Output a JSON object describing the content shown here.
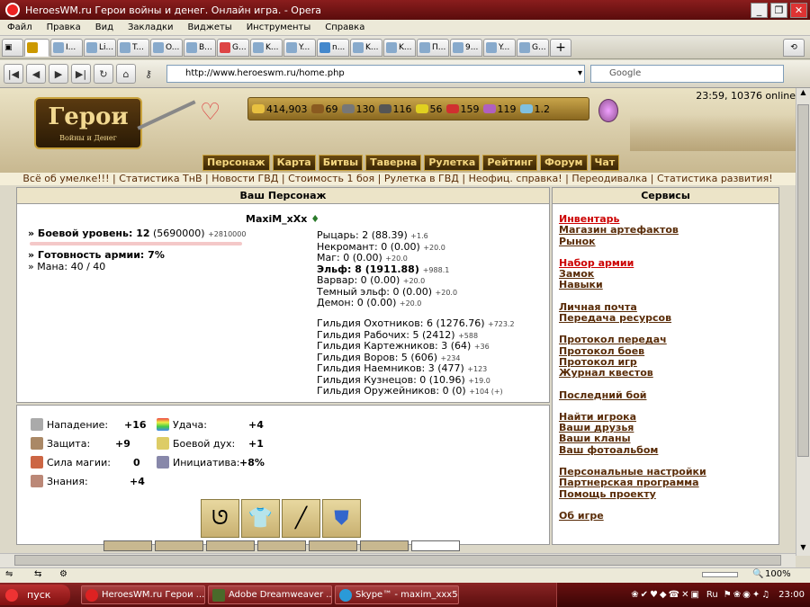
{
  "window": {
    "title": "HeroesWM.ru Герои войны и денег. Онлайн игра. - Opera"
  },
  "menu": [
    "Файл",
    "Правка",
    "Вид",
    "Закладки",
    "Виджеты",
    "Инструменты",
    "Справка"
  ],
  "tabs": [
    "",
    "I...",
    "Li...",
    "T...",
    "O...",
    "B...",
    "G...",
    "K...",
    "Y...",
    "n...",
    "K...",
    "K...",
    "П...",
    "9...",
    "Y...",
    "G..."
  ],
  "address": {
    "url": "http://www.heroeswm.ru/home.php",
    "search_placeholder": "Google"
  },
  "game": {
    "logo_title": "Герои",
    "logo_subtitle": "Войны и Денег",
    "server_time": "23:59, 10376 online",
    "resources": [
      "414,903",
      "69",
      "130",
      "116",
      "56",
      "159",
      "119",
      "1.2"
    ],
    "nav": [
      "Персонаж",
      "Карта",
      "Битвы",
      "Таверна",
      "Рулетка",
      "Рейтинг",
      "Форум",
      "Чат"
    ],
    "links_row": "Всё об умелке!!! | Статистика ТнВ | Новости ГВД | Стоимость 1 боя | Рулетка в ГВД | Неофиц. справка! | Переодивалка | Статистика развития!"
  },
  "character": {
    "panel_title": "Ваш Персонаж",
    "name": "MaxiM_xXx",
    "level_label": "» Боевой уровень: 12",
    "level_exp": "(5690000)",
    "level_next": "+2810000",
    "army": "» Готовность армии: 7%",
    "mana": "» Мана: 40 / 40",
    "factions": [
      {
        "text": "Рыцарь: 2 (88.39)",
        "delta": "+1.6"
      },
      {
        "text": "Некромант: 0 (0.00)",
        "delta": "+20.0"
      },
      {
        "text": "Маг: 0 (0.00)",
        "delta": "+20.0"
      },
      {
        "text": "Эльф: 8 (1911.88)",
        "delta": "+988.1"
      },
      {
        "text": "Варвар: 0 (0.00)",
        "delta": "+20.0"
      },
      {
        "text": "Темный эльф: 0 (0.00)",
        "delta": "+20.0"
      },
      {
        "text": "Демон: 0 (0.00)",
        "delta": "+20.0"
      }
    ],
    "guilds": [
      {
        "text": "Гильдия Охотников: 6 (1276.76)",
        "delta": "+723.2"
      },
      {
        "text": "Гильдия Рабочих: 5 (2412)",
        "delta": "+588"
      },
      {
        "text": "Гильдия Картежников: 3 (64)",
        "delta": "+36"
      },
      {
        "text": "Гильдия Воров: 5 (606)",
        "delta": "+234"
      },
      {
        "text": "Гильдия Наемников: 3 (477)",
        "delta": "+123"
      },
      {
        "text": "Гильдия Кузнецов: 0 (10.96)",
        "delta": "+19.0"
      },
      {
        "text": "Гильдия Оружейников: 0 (0)",
        "delta": "+104 (+)"
      }
    ]
  },
  "stats": [
    {
      "label": "Нападение:",
      "value": "+16"
    },
    {
      "label": "Защита:",
      "value": "+9"
    },
    {
      "label": "Сила магии:",
      "value": "0"
    },
    {
      "label": "Знания:",
      "value": "+4"
    },
    {
      "label": "Удача:",
      "value": "+4"
    },
    {
      "label": "Боевой дух:",
      "value": "+1"
    },
    {
      "label": "Инициатива:",
      "value": "+8%"
    }
  ],
  "services": {
    "title": "Сервисы",
    "groups": [
      [
        "Инвентарь",
        "Магазин артефактов",
        "Рынок"
      ],
      [
        "Набор армии",
        "Замок",
        "Навыки"
      ],
      [
        "Личная почта",
        "Передача ресурсов"
      ],
      [
        "Протокол передач",
        "Протокол боев",
        "Протокол игр",
        "Журнал квестов"
      ],
      [
        "Последний бой"
      ],
      [
        "Найти игрока",
        "Ваши друзья",
        "Ваши кланы",
        "Ваш фотоальбом"
      ],
      [
        "Персональные настройки",
        "Партнерская программа",
        "Помощь проекту"
      ],
      [
        "Об игре"
      ]
    ]
  },
  "statusbar": {
    "zoom": "100%"
  },
  "taskbar": {
    "start": "пуск",
    "tasks": [
      "HeroesWM.ru Герои ...",
      "Adobe Dreamweaver ...",
      "Skype™ - maxim_xxx5"
    ],
    "lang": "Ru",
    "clock": "23:00"
  }
}
